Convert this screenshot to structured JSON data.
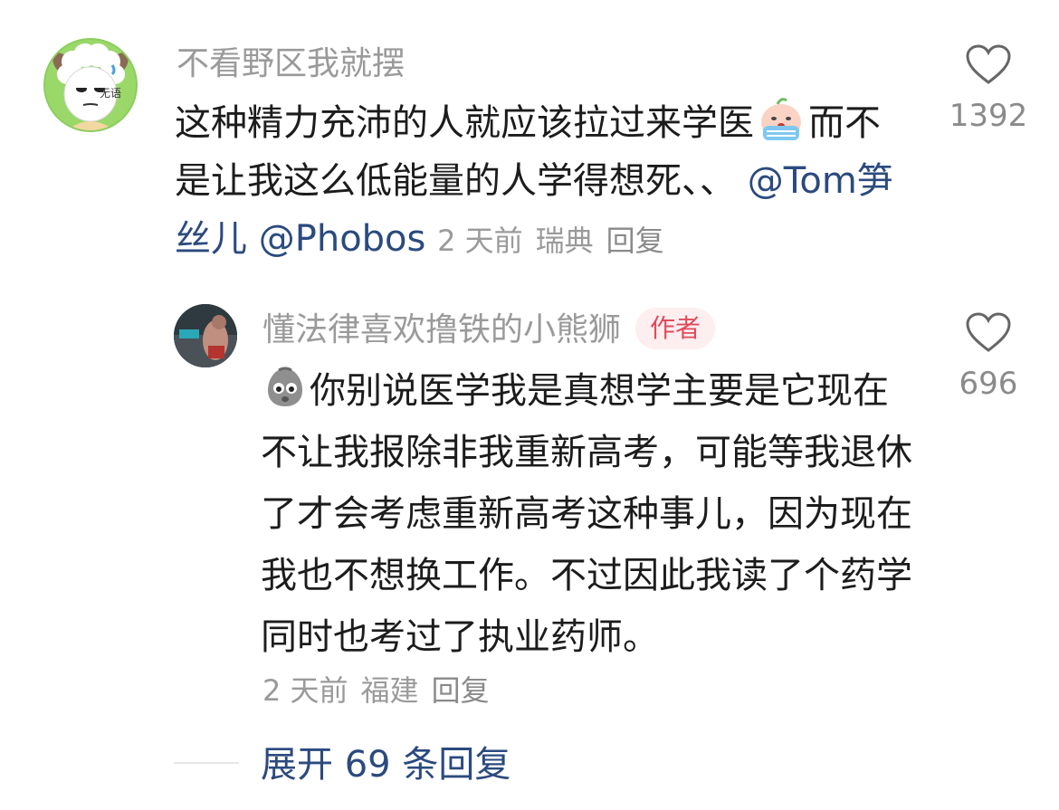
{
  "comment": {
    "username": "不看野区我就摆",
    "avatar_label": "无语",
    "text_before_emoji": "这种精力充沛的人就应该拉过来学医",
    "emoji_name": "crying-emoji",
    "text_after_emoji": "而不是让我这么低能量的人学得想死、、",
    "mentions": [
      "@Tom笋丝儿",
      "@Phobos"
    ],
    "time": "2 天前",
    "location": "瑞典",
    "reply_label": "回复",
    "like_count": "1392"
  },
  "reply": {
    "username": "懂法律喜欢撸铁的小熊狮",
    "author_badge": "作者",
    "emoji_name": "worried-face-emoji",
    "text": "你别说医学我是真想学主要是它现在不让我报除非我重新高考，可能等我退休了才会考虑重新高考这种事儿，因为现在我也不想换工作。不过因此我读了个药学同时也考过了执业药师。",
    "time": "2 天前",
    "location": "福建",
    "reply_label": "回复",
    "like_count": "696"
  },
  "expand_label": "展开 69 条回复",
  "colors": {
    "mention": "#2b4a7e",
    "muted": "#9a9a9a",
    "badge_text": "#e04a5a",
    "badge_bg": "#fdeef0"
  }
}
